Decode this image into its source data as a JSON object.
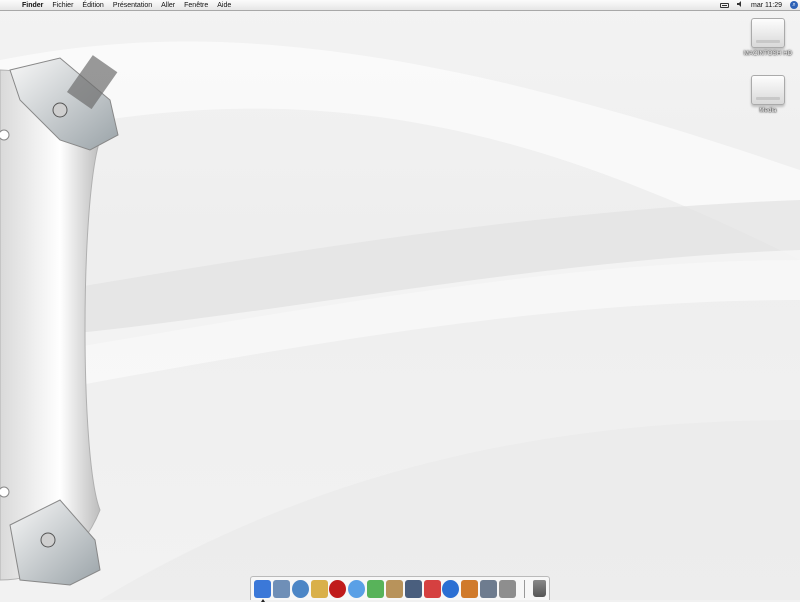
{
  "menubar": {
    "apple_glyph": "",
    "app_name": "Finder",
    "menus": [
      "Fichier",
      "Édition",
      "Présentation",
      "Aller",
      "Fenêtre",
      "Aide"
    ],
    "clock": "mar 11:29"
  },
  "desktop": {
    "icons": [
      {
        "name": "hard-drive-icon",
        "label": "MACINTOSH HD"
      },
      {
        "name": "media-drive-icon",
        "label": "Media"
      }
    ]
  },
  "dock": {
    "apps": [
      {
        "name": "finder-icon",
        "color": "#3b78d8"
      },
      {
        "name": "mail-icon",
        "color": "#6f8fb7"
      },
      {
        "name": "safari-icon",
        "color": "#4c86c6"
      },
      {
        "name": "textedit-icon",
        "color": "#d9b04a"
      },
      {
        "name": "quicktime-red-icon",
        "color": "#c01b1b"
      },
      {
        "name": "ichat-icon",
        "color": "#5aa0e6"
      },
      {
        "name": "itunes-icon",
        "color": "#58b35a"
      },
      {
        "name": "address-book-icon",
        "color": "#b8935b"
      },
      {
        "name": "iphoto-icon",
        "color": "#4a5f7e"
      },
      {
        "name": "ical-icon",
        "color": "#d54040"
      },
      {
        "name": "quicktime-icon",
        "color": "#2b6fd3"
      },
      {
        "name": "preview-icon",
        "color": "#d07a2b"
      },
      {
        "name": "utilities-icon",
        "color": "#6e7c8f"
      },
      {
        "name": "system-prefs-icon",
        "color": "#8e8e8e"
      }
    ],
    "trash": {
      "name": "trash-icon",
      "color": "#555555"
    }
  }
}
